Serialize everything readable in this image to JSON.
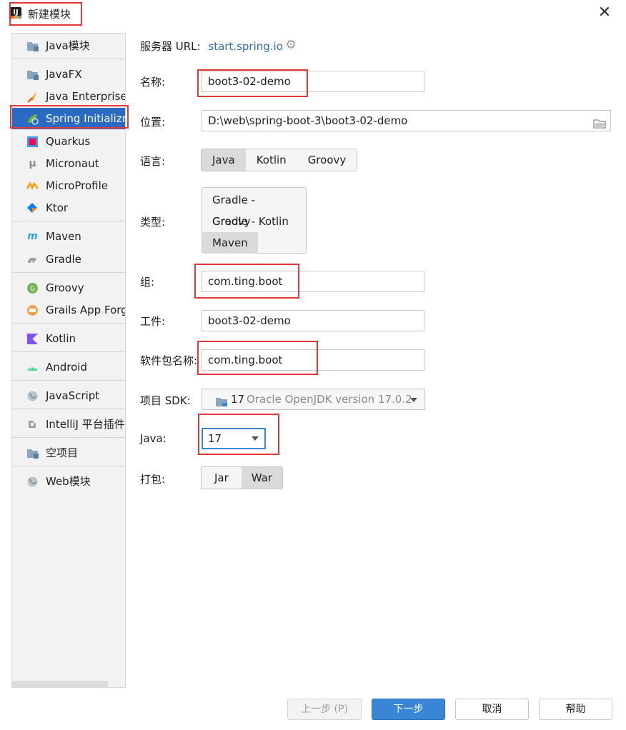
{
  "window": {
    "title": "新建模块",
    "app_icon_text": "IJ",
    "close_symbol": "✕"
  },
  "sidebar": {
    "items": [
      {
        "label": "Java模块",
        "icon": "folder-icon"
      },
      {
        "label": "JavaFX",
        "icon": "folder-icon"
      },
      {
        "label": "Java Enterprise",
        "icon": "java-enterprise-icon"
      },
      {
        "label": "Spring Initializr",
        "icon": "spring-icon",
        "selected": true
      },
      {
        "label": "Quarkus",
        "icon": "quarkus-icon"
      },
      {
        "label": "Micronaut",
        "icon": "micronaut-icon"
      },
      {
        "label": "MicroProfile",
        "icon": "microprofile-icon"
      },
      {
        "label": "Ktor",
        "icon": "ktor-icon"
      },
      {
        "label": "Maven",
        "icon": "maven-icon"
      },
      {
        "label": "Gradle",
        "icon": "gradle-icon"
      },
      {
        "label": "Groovy",
        "icon": "groovy-icon"
      },
      {
        "label": "Grails App Forg",
        "icon": "grails-icon"
      },
      {
        "label": "Kotlin",
        "icon": "kotlin-icon"
      },
      {
        "label": "Android",
        "icon": "android-icon"
      },
      {
        "label": "JavaScript",
        "icon": "globe-icon"
      },
      {
        "label": "IntelliJ 平台插件",
        "icon": "plugin-icon"
      },
      {
        "label": "空项目",
        "icon": "folder-icon"
      },
      {
        "label": "Web模块",
        "icon": "globe-icon"
      }
    ]
  },
  "form": {
    "server_url_label": "服务器 URL:",
    "server_url_value": "start.spring.io",
    "name_label": "名称:",
    "name_value": "boot3-02-demo",
    "location_label": "位置:",
    "location_value": "D:\\web\\spring-boot-3\\boot3-02-demo",
    "language_label": "语言:",
    "languages": [
      "Java",
      "Kotlin",
      "Groovy"
    ],
    "language_selected": "Java",
    "type_label": "类型:",
    "types": [
      "Gradle - Groovy",
      "Gradle - Kotlin",
      "Maven"
    ],
    "type_selected": "Maven",
    "group_label": "组:",
    "group_value": "com.ting.boot",
    "artifact_label": "工件:",
    "artifact_value": "boot3-02-demo",
    "package_label": "软件包名称:",
    "package_value": "com.ting.boot",
    "sdk_label": "项目 SDK:",
    "sdk_version": "17",
    "sdk_name": "Oracle OpenJDK version 17.0.2",
    "java_label": "Java:",
    "java_value": "17",
    "packaging_label": "打包:",
    "packagings": [
      "Jar",
      "War"
    ],
    "packaging_selected": "War"
  },
  "footer": {
    "prev_label": "上一步 (P)",
    "next_label": "下一步",
    "cancel_label": "取消",
    "help_label": "帮助"
  },
  "colors": {
    "accent": "#2a6ac2",
    "highlight": "#e53935",
    "link": "#2f6db4",
    "primary_button": "#3a86d6"
  }
}
